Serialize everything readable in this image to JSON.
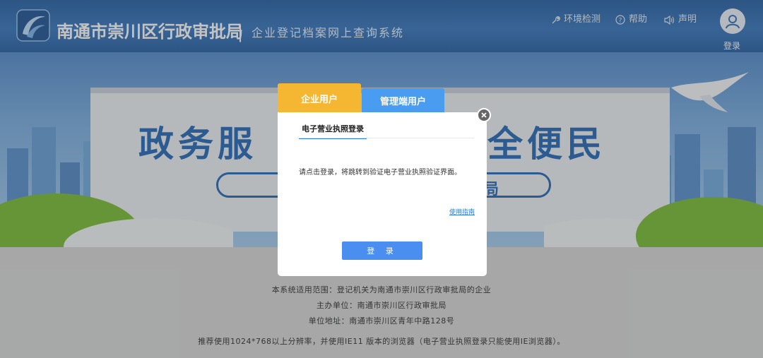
{
  "header": {
    "site_title": "南通市崇川区行政审批局",
    "separator": "|",
    "system_name": "企业登记档案网上查询系统",
    "links": {
      "env_check": "环境检测",
      "help": "帮助",
      "statement": "声明"
    },
    "login_label": "登录"
  },
  "banner": {
    "slogan_left": "政务服",
    "slogan_right": "全便民",
    "pill_text": "局"
  },
  "footer": {
    "scope": "本系统适用范围：登记机关为南通市崇川区行政审批局的企业",
    "host": "主办单位：南通市崇川区行政审批局",
    "address": "单位地址：南通市崇川区青年中路128号",
    "recommend": "推荐使用1024*768以上分辨率，并使用IE11 版本的浏览器（电子营业执照登录只能使用IE浏览器）。"
  },
  "modal": {
    "tabs": {
      "enterprise": "企业用户",
      "admin": "管理端用户"
    },
    "sub_tab": "电子营业执照登录",
    "hint": "请点击登录，将跳转到验证电子营业执照验证界面。",
    "guide_link": "使用指南",
    "login_button": "登 录"
  },
  "colors": {
    "header_bg": "#3a76bb",
    "tab_enterprise": "#f5b731",
    "tab_admin": "#4a9cf0",
    "primary_button": "#4a8ff0"
  }
}
